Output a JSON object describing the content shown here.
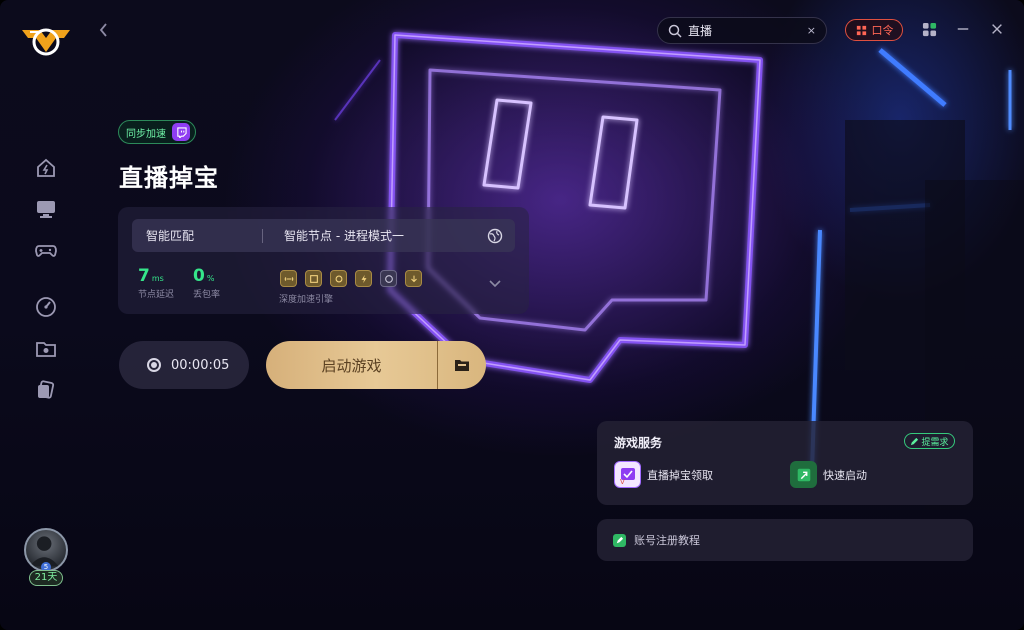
{
  "app": {
    "logo_icon": "vanguard-wings-logo",
    "accent": "#35e58a",
    "gold": "#e3c28e"
  },
  "sidebar": {
    "items": [
      {
        "icon": "home-icon"
      },
      {
        "icon": "monitor-icon"
      },
      {
        "icon": "gamepad-icon"
      },
      {
        "icon": "speedometer-icon"
      },
      {
        "icon": "folder-icon"
      },
      {
        "icon": "cards-icon"
      }
    ],
    "user": {
      "level": "5",
      "days": "21天"
    }
  },
  "topbar": {
    "search_value": "直播",
    "promo_label": "口令",
    "clear_glyph": "×"
  },
  "game": {
    "sync_label": "同步加速",
    "title": "直播掉宝"
  },
  "panel": {
    "match_label": "智能匹配",
    "node_label": "智能节点 - 进程模式一",
    "latency": {
      "value": "7",
      "unit": "ms",
      "label": "节点延迟"
    },
    "loss": {
      "value": "0",
      "unit": "%",
      "label": "丢包率"
    },
    "engine_label": "深度加速引擎"
  },
  "controls": {
    "timer": "00:00:05",
    "launch_label": "启动游戏"
  },
  "services": {
    "title": "游戏服务",
    "request_label": "提需求",
    "items": [
      {
        "label": "直播掉宝领取",
        "icon": "twitch-drops-icon"
      },
      {
        "label": "快速启动",
        "icon": "quick-launch-icon"
      }
    ]
  },
  "tutorial": {
    "label": "账号注册教程"
  }
}
